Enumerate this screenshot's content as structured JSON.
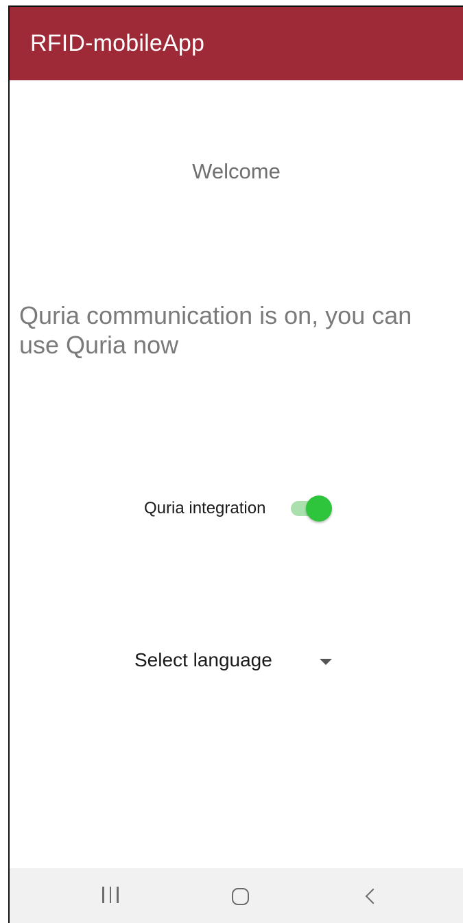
{
  "app_bar": {
    "title": "RFID-mobileApp"
  },
  "main": {
    "welcome": "Welcome",
    "status_message": "Quria communication is on, you can use Quria now",
    "integration": {
      "label": "Quria integration",
      "enabled": true
    },
    "language": {
      "label": "Select language"
    }
  },
  "nav_bar": {
    "icons": [
      "recents-icon",
      "home-icon",
      "back-icon"
    ]
  },
  "colors": {
    "app_bar": "#9e2937",
    "switch_on": "#2ec43c",
    "switch_track": "#a9e0ae",
    "nav_bar": "#f1f1f1"
  }
}
